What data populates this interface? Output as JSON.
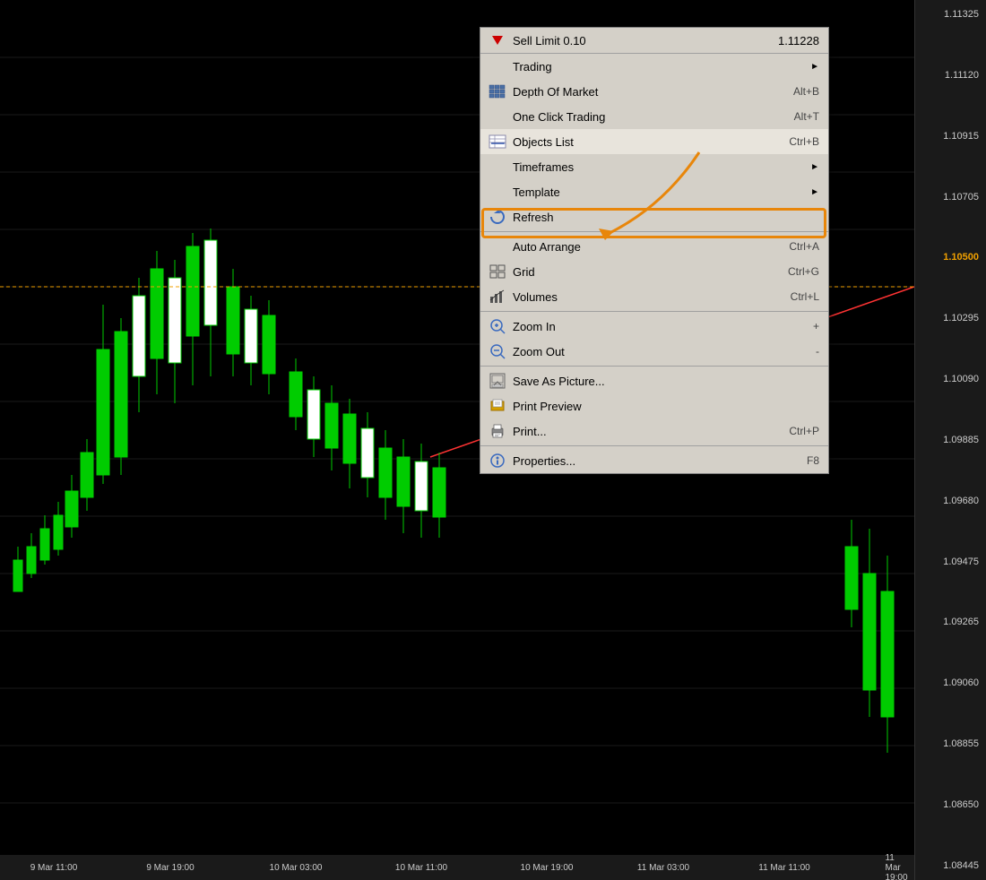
{
  "chart": {
    "background": "#000000",
    "priceLabels": [
      "1.11325",
      "1.11120",
      "1.10915",
      "1.10705",
      "1.10500",
      "1.10295",
      "1.10090",
      "1.09885",
      "1.09680",
      "1.09475",
      "1.09265",
      "1.09060",
      "1.08855",
      "1.08650",
      "1.08445"
    ],
    "timeLabels": [
      {
        "label": "9 Mar 11:00",
        "pos": 60
      },
      {
        "label": "9 Mar 19:00",
        "pos": 190
      },
      {
        "label": "10 Mar 03:00",
        "pos": 330
      },
      {
        "label": "10 Mar 11:00",
        "pos": 470
      },
      {
        "label": "10 Mar 19:00",
        "pos": 610
      },
      {
        "label": "11 Mar 03:00",
        "pos": 740
      },
      {
        "label": "11 Mar 11:00",
        "pos": 875
      },
      {
        "label": "11 Mar 19:00",
        "pos": 1000
      }
    ]
  },
  "contextMenu": {
    "sellLimitLabel": "Sell Limit 0.10",
    "sellLimitPrice": "1.11228",
    "items": [
      {
        "id": "trading",
        "icon": "none",
        "label": "Trading",
        "shortcut": "",
        "hasArrow": true
      },
      {
        "id": "depth-of-market",
        "icon": "grid",
        "label": "Depth Of Market",
        "shortcut": "Alt+B",
        "hasArrow": false
      },
      {
        "id": "one-click-trading",
        "icon": "none",
        "label": "One Click Trading",
        "shortcut": "Alt+T",
        "hasArrow": false
      },
      {
        "id": "objects-list",
        "icon": "objects",
        "label": "Objects List",
        "shortcut": "Ctrl+B",
        "hasArrow": false,
        "highlighted": true
      },
      {
        "id": "timeframes",
        "icon": "none",
        "label": "Timeframes",
        "shortcut": "",
        "hasArrow": true
      },
      {
        "id": "template",
        "icon": "none",
        "label": "Template",
        "shortcut": "",
        "hasArrow": true
      },
      {
        "id": "refresh",
        "icon": "refresh",
        "label": "Refresh",
        "shortcut": "",
        "hasArrow": false
      },
      {
        "id": "separator1",
        "type": "separator"
      },
      {
        "id": "auto-arrange",
        "icon": "none",
        "label": "Auto Arrange",
        "shortcut": "Ctrl+A",
        "hasArrow": false
      },
      {
        "id": "grid",
        "icon": "grid2",
        "label": "Grid",
        "shortcut": "Ctrl+G",
        "hasArrow": false
      },
      {
        "id": "volumes",
        "icon": "volumes",
        "label": "Volumes",
        "shortcut": "Ctrl+L",
        "hasArrow": false
      },
      {
        "id": "separator2",
        "type": "separator"
      },
      {
        "id": "zoom-in",
        "icon": "zoom-in",
        "label": "Zoom In",
        "shortcut": "+",
        "hasArrow": false
      },
      {
        "id": "zoom-out",
        "icon": "zoom-out",
        "label": "Zoom Out",
        "shortcut": "-",
        "hasArrow": false
      },
      {
        "id": "separator3",
        "type": "separator"
      },
      {
        "id": "save-as-picture",
        "icon": "save",
        "label": "Save As Picture...",
        "shortcut": "",
        "hasArrow": false
      },
      {
        "id": "print-preview",
        "icon": "print-preview",
        "label": "Print Preview",
        "shortcut": "",
        "hasArrow": false
      },
      {
        "id": "print",
        "icon": "print",
        "label": "Print...",
        "shortcut": "Ctrl+P",
        "hasArrow": false
      },
      {
        "id": "separator4",
        "type": "separator"
      },
      {
        "id": "properties",
        "icon": "properties",
        "label": "Properties...",
        "shortcut": "F8",
        "hasArrow": false
      }
    ]
  }
}
